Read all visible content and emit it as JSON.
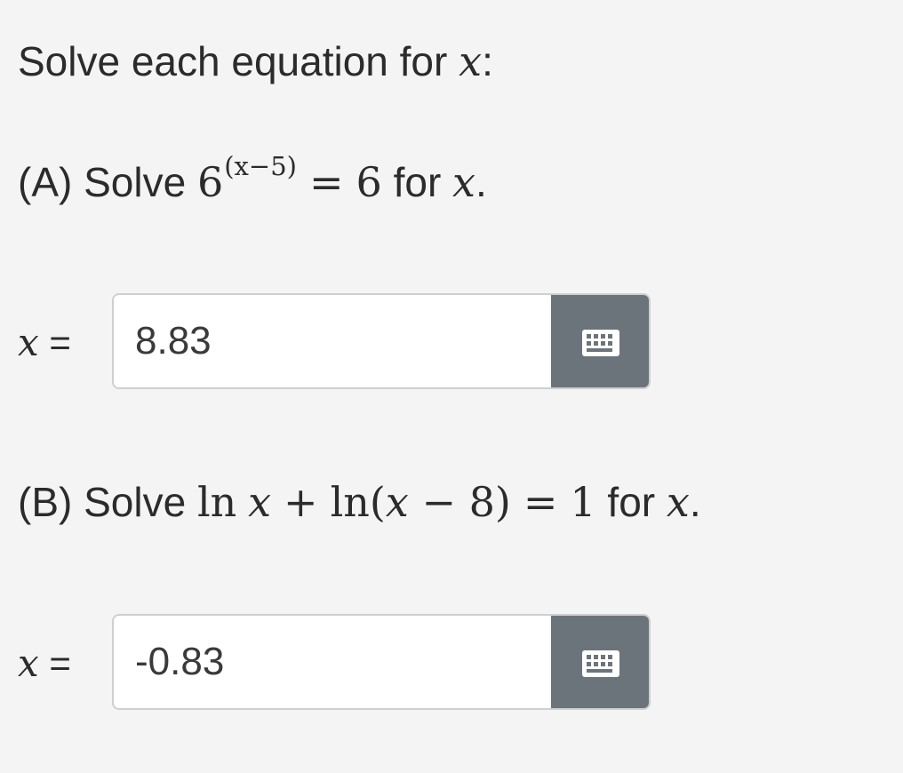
{
  "prompt": {
    "text": "Solve each equation for ",
    "variable": "x",
    "colon": ":"
  },
  "part_a": {
    "prefix": "(A) Solve ",
    "base": "6",
    "exponent": "(x−5)",
    "equals": "=",
    "rhs": "6",
    "for_text": " for ",
    "variable": "x",
    "period": ".",
    "answer_label_var": "x",
    "answer_label_eq": " =",
    "answer_value": "8.83"
  },
  "part_b": {
    "prefix": "(B) Solve ",
    "ln1": "ln",
    "var1": "x",
    "plus": "+",
    "ln2": "ln(",
    "var2": "x",
    "minus_eight": " − 8)",
    "equals": "=",
    "rhs": "1",
    "for_text": " for ",
    "variable": "x",
    "period": ".",
    "answer_label_var": "x",
    "answer_label_eq": " =",
    "answer_value": "-0.83"
  },
  "icons": {
    "keyboard": "keyboard-icon"
  },
  "colors": {
    "background": "#f4f4f4",
    "button": "#6c747b",
    "input_border": "#cfcfcf",
    "text": "#2b2b2b"
  }
}
